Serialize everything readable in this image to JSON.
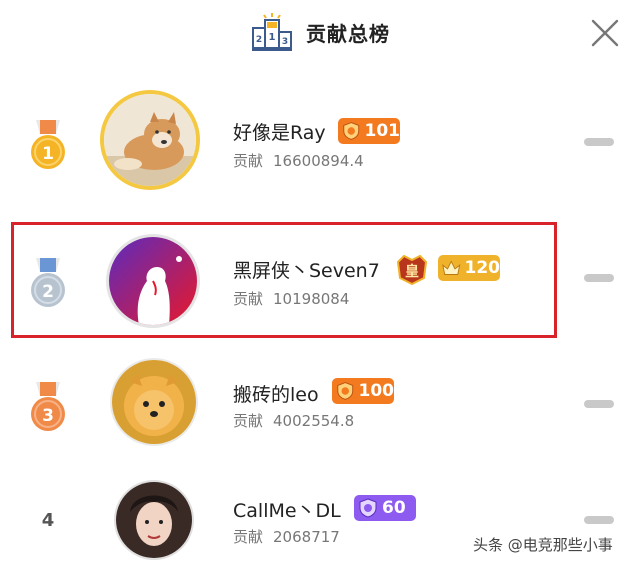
{
  "header": {
    "title": "贡献总榜",
    "podium_icon": "podium-icon",
    "close_icon": "close-icon"
  },
  "contribution_label": "贡献",
  "rows": [
    {
      "rank": "1",
      "name": "好像是Ray",
      "level": "101",
      "contribution": "16600894.4",
      "badge_color": "#f37a1f"
    },
    {
      "rank": "2",
      "name": "黑屏侠丶Seven7",
      "level": "120",
      "contribution": "10198084",
      "badge_color": "#f0b22a",
      "crown_badge": "皇"
    },
    {
      "rank": "3",
      "name": "搬砖的leo",
      "level": "100",
      "contribution": "4002554.8",
      "badge_color": "#f37a1f"
    },
    {
      "rank": "4",
      "name": "CallMe丶DL",
      "level": "60",
      "contribution": "2068717",
      "badge_color": "#8e5bf0"
    }
  ],
  "watermark": "头条 @电竞那些小事",
  "colors": {
    "gold": "#f5b425",
    "silver": "#b7c3cf",
    "bronze": "#f08a48",
    "highlight": "#d8232a"
  }
}
